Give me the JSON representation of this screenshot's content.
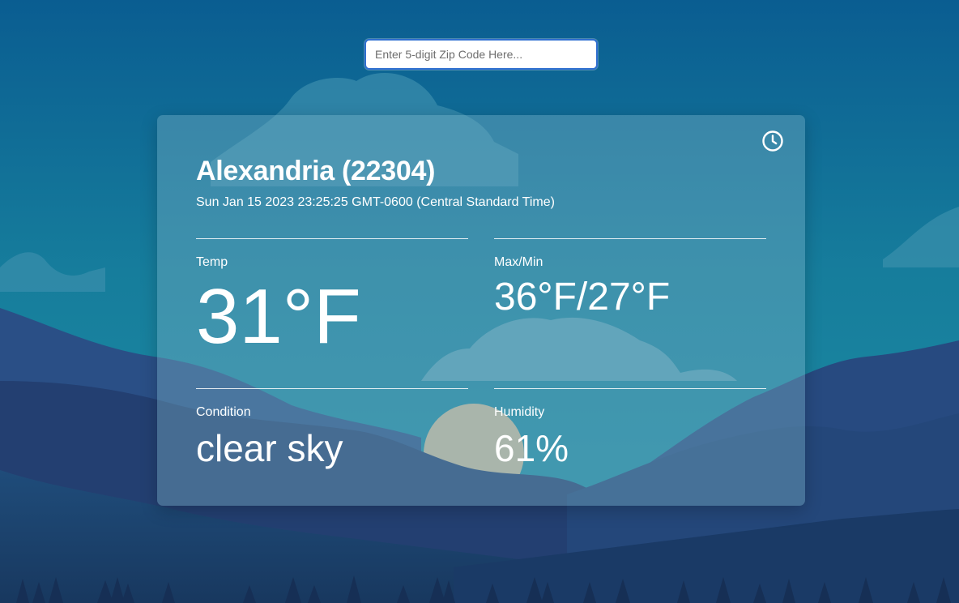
{
  "search": {
    "placeholder": "Enter 5-digit Zip Code Here...",
    "value": ""
  },
  "weather": {
    "location": "Alexandria (22304)",
    "datetime": "Sun Jan 15 2023 23:25:25 GMT-0600 (Central Standard Time)",
    "temp_label": "Temp",
    "temp_value": "31°F",
    "maxmin_label": "Max/Min",
    "maxmin_value": "36°F/27°F",
    "condition_label": "Condition",
    "condition_value": "clear sky",
    "humidity_label": "Humidity",
    "humidity_value": "61%"
  },
  "icons": {
    "history": "clock-icon"
  },
  "colors": {
    "sky_top": "#0a5d91",
    "sky_mid": "#167d9c",
    "mountains_dark": "#1e3b6b",
    "sun": "#c9b89a",
    "card_tint": "#7ab2c6",
    "input_border": "#2f6fd0"
  }
}
